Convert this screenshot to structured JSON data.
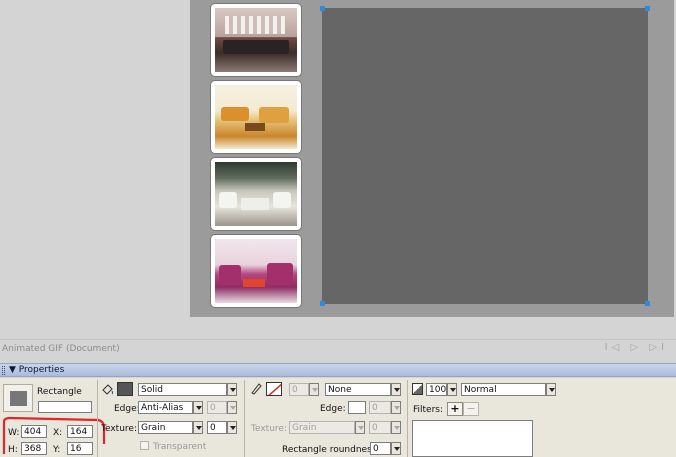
{
  "document": {
    "title": "Animated GIF (Document)",
    "nav_controls": "I◁ ▷ ▷I"
  },
  "properties": {
    "header_label": "▼ Properties",
    "shape_name": "Rectangle",
    "w_label": "W:",
    "w_value": "404",
    "x_label": "X:",
    "x_value": "164",
    "h_label": "H:",
    "h_value": "368",
    "y_label": "Y:",
    "y_value": "16",
    "fill_type": "Solid",
    "edge_label": "Edge:",
    "edge_value": "Anti-Alias",
    "edge_amount": "0",
    "texture_label": "Texture:",
    "texture_value": "Grain",
    "texture_amount": "0",
    "transparent_label": "Transparent",
    "stroke_size": "0",
    "stroke_type": "None",
    "stroke_edge_label": "Edge:",
    "stroke_edge_amount": "0",
    "stroke_texture_label": "Texture:",
    "stroke_texture_value": "Grain",
    "stroke_texture_amount": "0",
    "roundness_label": "Rectangle roundness:",
    "roundness_value": "0",
    "opacity_value": "100",
    "blend_mode": "Normal",
    "filters_label": "Filters:",
    "filter_add": "+",
    "filter_remove": "−"
  },
  "colors": {
    "fill_color": "#555555",
    "selection_handle": "#2d8ae0",
    "annotation_red": "#e0262a"
  },
  "icons": {
    "fill": "paint-bucket-icon",
    "stroke": "pencil-icon",
    "opacity": "opacity-icon"
  }
}
